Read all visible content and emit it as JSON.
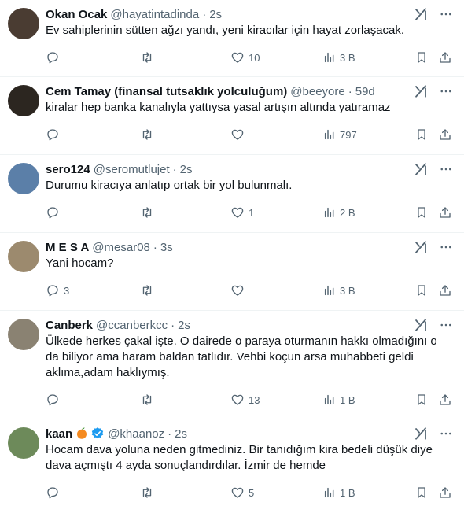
{
  "colors": {
    "text": "#0f1419",
    "muted": "#536471",
    "divider": "#eff3f4",
    "verified": "#1d9bf0"
  },
  "tweets": [
    {
      "name": "Okan Ocak",
      "handle": "@hayatintadinda",
      "dot": "·",
      "time": "2s",
      "text": "Ev sahiplerinin sütten ağzı yandı, yeni kiracılar için hayat zorlaşacak.",
      "replies": "",
      "retweets": "",
      "likes": "10",
      "views": "3 B",
      "avatar": "#4a3c32"
    },
    {
      "name": "Cem Tamay (finansal tutsaklık yolculuğum)",
      "handle": "@beeyore",
      "dot": "·",
      "time": "59d",
      "text": "kiralar hep banka kanalıyla yattıysa yasal artışın altında yatıramaz",
      "replies": "",
      "retweets": "",
      "likes": "",
      "views": "797",
      "avatar": "#2c2620"
    },
    {
      "name": "sero124",
      "handle": "@seromutlujet",
      "dot": "·",
      "time": "2s",
      "text": "Durumu kiracıya anlatıp ortak bir yol bulunmalı.",
      "replies": "",
      "retweets": "",
      "likes": "1",
      "views": "2 B",
      "avatar": "#5b7fa8"
    },
    {
      "name": "M E S A",
      "handle": "@mesar08",
      "dot": "·",
      "time": "3s",
      "text": "Yani hocam?",
      "replies": "3",
      "retweets": "",
      "likes": "",
      "views": "3 B",
      "avatar": "#9c8a6e"
    },
    {
      "name": "Canberk",
      "handle": "@ccanberkcc",
      "dot": "·",
      "time": "2s",
      "text": "Ülkede herkes çakal işte. O dairede o paraya oturmanın hakkı olmadığını o da biliyor ama haram baldan tatlıdır. Vehbi koçun arsa muhabbeti geldi aklıma,adam haklıymış.",
      "replies": "",
      "retweets": "",
      "likes": "13",
      "views": "1 B",
      "avatar": "#8a8272"
    },
    {
      "name": "kaan",
      "handle": "@khaanoz",
      "dot": "·",
      "time": "2s",
      "text": "Hocam dava yoluna neden gitmediniz. Bir tanıdığım kira bedeli düşük diye dava açmıştı 4 ayda sonuçlandırdılar. İzmir de hemde",
      "replies": "",
      "retweets": "",
      "likes": "5",
      "views": "1 B",
      "avatar": "#6d8a5a"
    }
  ]
}
